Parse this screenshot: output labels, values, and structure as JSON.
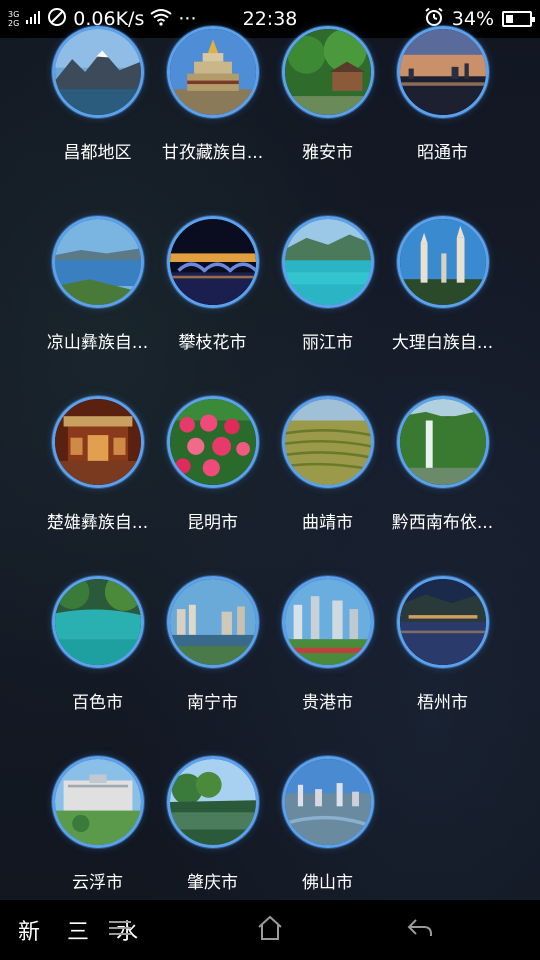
{
  "status_bar": {
    "network_top": "3G",
    "network_bottom": "2G",
    "speed": "0.06K/s",
    "more": "···",
    "time": "22:38",
    "battery": "34%",
    "battery_level": 0.34
  },
  "cities": [
    {
      "label": "昌都地区",
      "scene": "mountain"
    },
    {
      "label": "甘孜藏族自...",
      "scene": "temple"
    },
    {
      "label": "雅安市",
      "scene": "forest-house"
    },
    {
      "label": "昭通市",
      "scene": "dusk-city"
    },
    {
      "label": "凉山彝族自...",
      "scene": "lake"
    },
    {
      "label": "攀枝花市",
      "scene": "night-bridge"
    },
    {
      "label": "丽江市",
      "scene": "turquoise-lake"
    },
    {
      "label": "大理白族自...",
      "scene": "pagodas"
    },
    {
      "label": "楚雄彝族自...",
      "scene": "palace"
    },
    {
      "label": "昆明市",
      "scene": "tulips"
    },
    {
      "label": "曲靖市",
      "scene": "terraces"
    },
    {
      "label": "黔西南布依...",
      "scene": "waterfall"
    },
    {
      "label": "百色市",
      "scene": "green-pool"
    },
    {
      "label": "南宁市",
      "scene": "river-city"
    },
    {
      "label": "贵港市",
      "scene": "towers"
    },
    {
      "label": "梧州市",
      "scene": "night-river"
    },
    {
      "label": "云浮市",
      "scene": "plaza"
    },
    {
      "label": "肇庆市",
      "scene": "green-river"
    },
    {
      "label": "佛山市",
      "scene": "aerial-city"
    }
  ],
  "nav": {
    "watermark": "新 三 水"
  },
  "colors": {
    "ring": "#5aa2f0",
    "background": "#121722"
  }
}
